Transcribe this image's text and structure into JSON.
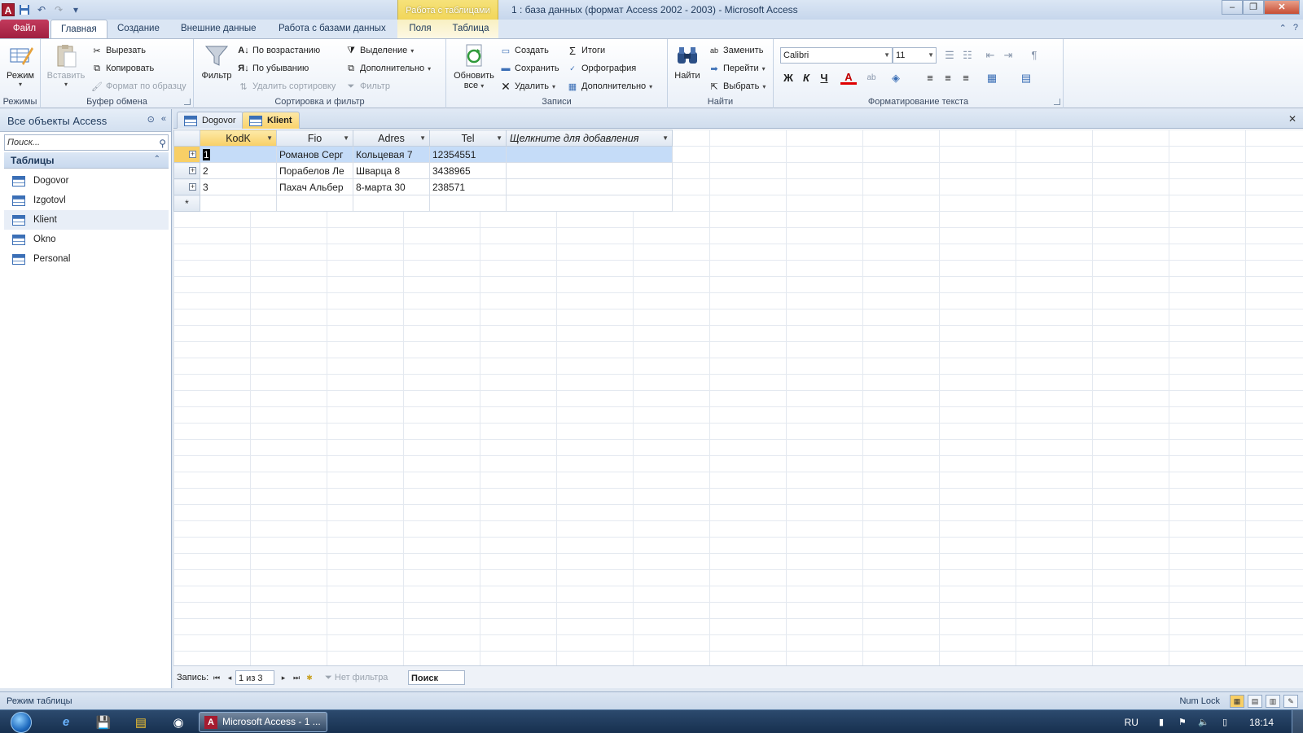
{
  "titlebar": {
    "context_tab": "Работа с таблицами",
    "title": "1 : база данных (формат Access 2002 - 2003)  -  Microsoft Access",
    "app_icon": "A"
  },
  "tabs": {
    "file": "Файл",
    "home": "Главная",
    "create": "Создание",
    "external": "Внешние данные",
    "dbtools": "Работа с базами данных",
    "fields": "Поля",
    "table": "Таблица"
  },
  "ribbon": {
    "views": {
      "label": "Режимы",
      "mode": "Режим"
    },
    "clipboard": {
      "label": "Буфер обмена",
      "paste": "Вставить",
      "cut": "Вырезать",
      "copy": "Копировать",
      "format_painter": "Формат по образцу"
    },
    "sort_filter": {
      "label": "Сортировка и фильтр",
      "filter": "Фильтр",
      "ascending": "По возрастанию",
      "descending": "По убыванию",
      "remove_sort": "Удалить сортировку",
      "selection": "Выделение",
      "advanced": "Дополнительно",
      "toggle_filter": "Фильтр"
    },
    "records": {
      "label": "Записи",
      "refresh": "Обновить",
      "refresh2": "все",
      "new": "Создать",
      "save": "Сохранить",
      "delete": "Удалить",
      "totals": "Итоги",
      "spelling": "Орфография",
      "more": "Дополнительно"
    },
    "find": {
      "label": "Найти",
      "find": "Найти",
      "replace": "Заменить",
      "goto": "Перейти",
      "select": "Выбрать"
    },
    "text_format": {
      "label": "Форматирование текста",
      "font": "Calibri",
      "size": "11",
      "bold": "Ж",
      "italic": "К",
      "underline": "Ч"
    }
  },
  "nav": {
    "title": "Все объекты Access",
    "search_placeholder": "Поиск...",
    "group": "Таблицы",
    "items": [
      {
        "label": "Dogovor"
      },
      {
        "label": "Izgotovl"
      },
      {
        "label": "Klient"
      },
      {
        "label": "Okno"
      },
      {
        "label": "Personal"
      }
    ]
  },
  "doc_tabs": [
    {
      "label": "Dogovor"
    },
    {
      "label": "Klient"
    }
  ],
  "table": {
    "columns": [
      "KodK",
      "Fio",
      "Adres",
      "Tel",
      "Щелкните для добавления"
    ],
    "rows": [
      [
        "1",
        "Романов Серг",
        "Кольцевая 7",
        "12354551",
        ""
      ],
      [
        "2",
        "Порабелов Ле",
        "Шварца 8",
        "3438965",
        ""
      ],
      [
        "3",
        "Пахач Альбер",
        "8-марта 30",
        "238571",
        ""
      ]
    ],
    "new_row_marker": "*"
  },
  "recnav": {
    "label": "Запись:",
    "position": "1 из 3",
    "filter": "Нет фильтра",
    "search": "Поиск"
  },
  "status": {
    "mode": "Режим таблицы",
    "numlock": "Num Lock"
  },
  "taskbar": {
    "task": "Microsoft Access - 1 ...",
    "lang": "RU",
    "time": "18:14"
  },
  "colors": {
    "file_tab": "#a01f40",
    "context_header": "#f1d65a",
    "active_doc_tab": "#f9d26a",
    "selected_row": "#c5dcf8"
  }
}
